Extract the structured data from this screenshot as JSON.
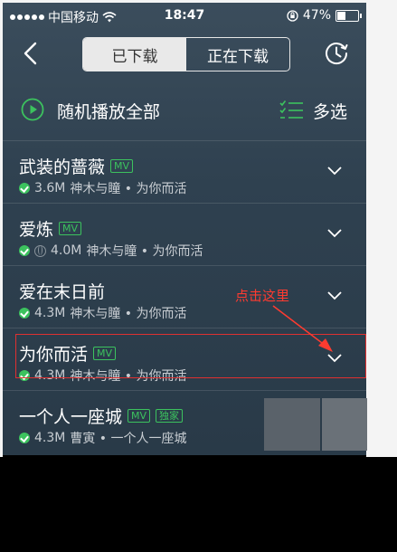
{
  "status": {
    "carrier": "中国移动",
    "time": "18:47",
    "battery": "47%",
    "battery_level": 0.47
  },
  "header": {
    "tabs": [
      {
        "label": "已下载",
        "active": true
      },
      {
        "label": "正在下载",
        "active": false
      }
    ]
  },
  "actions": {
    "play_all": "随机播放全部",
    "multi_select": "多选"
  },
  "songs": [
    {
      "title": "武装的蔷薇",
      "badges": [
        "MV"
      ],
      "size": "3.6M",
      "artist_album": "神木与瞳 • 为你而活",
      "network": false
    },
    {
      "title": "爱炼",
      "badges": [
        "MV"
      ],
      "size": "4.0M",
      "artist_album": "神木与瞳 • 为你而活",
      "network": true
    },
    {
      "title": "爱在末日前",
      "badges": [],
      "size": "4.3M",
      "artist_album": "神木与瞳 • 为你而活",
      "network": false
    },
    {
      "title": "为你而活",
      "badges": [
        "MV"
      ],
      "size": "4.3M",
      "artist_album": "神木与瞳 • 为你而活",
      "network": false
    },
    {
      "title": "一个人一座城",
      "badges": [
        "MV",
        "独家"
      ],
      "size": "4.3M",
      "artist_album": "曹寅 • 一个人一座城",
      "network": false
    }
  ],
  "annotation": {
    "text": "点击这里",
    "color": "#ff3b30"
  },
  "colors": {
    "accent": "#3cc25e",
    "background": "#2f4150"
  }
}
